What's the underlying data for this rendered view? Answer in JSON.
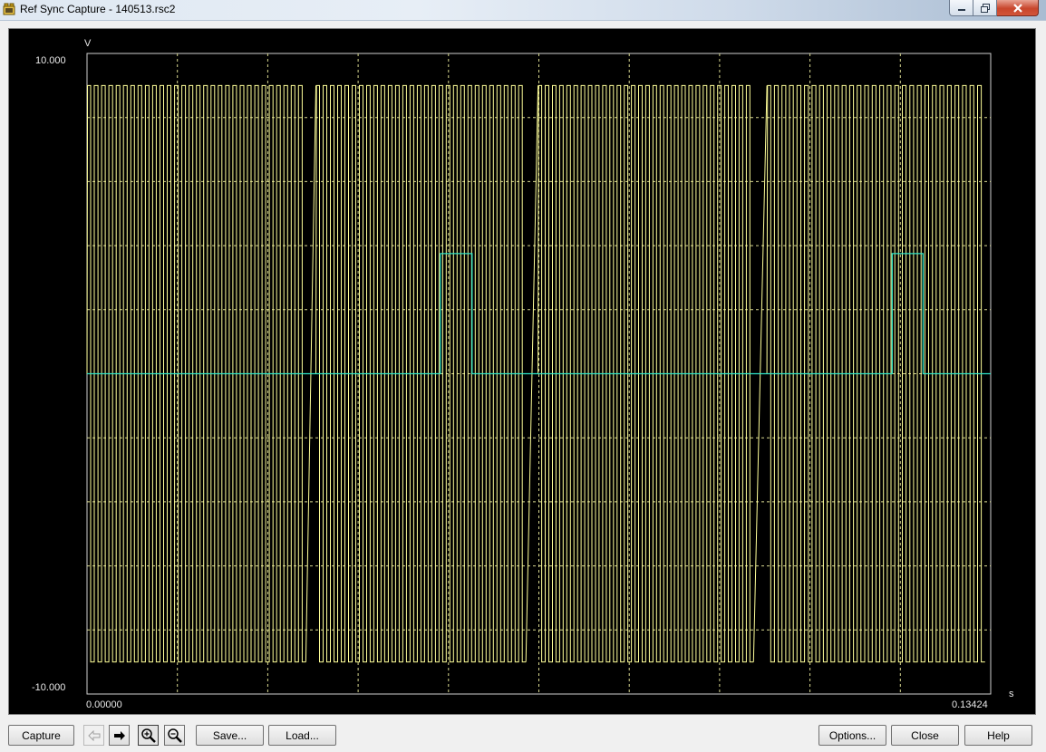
{
  "window": {
    "title": "Ref Sync Capture - 140513.rsc2"
  },
  "plot": {
    "y_unit": "V",
    "x_unit": "s",
    "y_max_label": "10.000",
    "y_min_label": "-10.000",
    "x_min_label": "0.00000",
    "x_max_label": "0.13424",
    "colors": {
      "background": "#000000",
      "grid": "#d8d890",
      "signal": "#ffff99",
      "reference": "#2ee6c8"
    }
  },
  "chart_data": {
    "type": "line",
    "xlabel": "s",
    "ylabel": "V",
    "xlim": [
      0.0,
      0.13424
    ],
    "ylim": [
      -10.0,
      10.0
    ],
    "grid": true,
    "series": [
      {
        "waveform": "square",
        "high": 9.0,
        "low": -9.0,
        "bursts": [
          {
            "start": 0.0,
            "end": 0.0325,
            "pulses": 30
          },
          {
            "start": 0.034,
            "end": 0.0652,
            "pulses": 29
          },
          {
            "start": 0.067,
            "end": 0.099,
            "pulses": 30
          },
          {
            "start": 0.101,
            "end": 0.1334,
            "pulses": 29
          }
        ]
      },
      {
        "waveform": "step",
        "points": [
          [
            0.0,
            0.0
          ],
          [
            0.0525,
            0.0
          ],
          [
            0.0525,
            3.75
          ],
          [
            0.0572,
            3.75
          ],
          [
            0.0572,
            0.0
          ],
          [
            0.1196,
            0.0
          ],
          [
            0.1196,
            3.75
          ],
          [
            0.1242,
            3.75
          ],
          [
            0.1242,
            0.0
          ],
          [
            0.13424,
            0.0
          ]
        ]
      }
    ]
  },
  "toolbar": {
    "capture_label": "Capture",
    "save_label": "Save...",
    "load_label": "Load...",
    "options_label": "Options...",
    "close_label": "Close",
    "help_label": "Help",
    "icons": [
      "arrow-left-icon",
      "arrow-right-icon",
      "zoom-in-icon",
      "zoom-out-icon"
    ]
  }
}
